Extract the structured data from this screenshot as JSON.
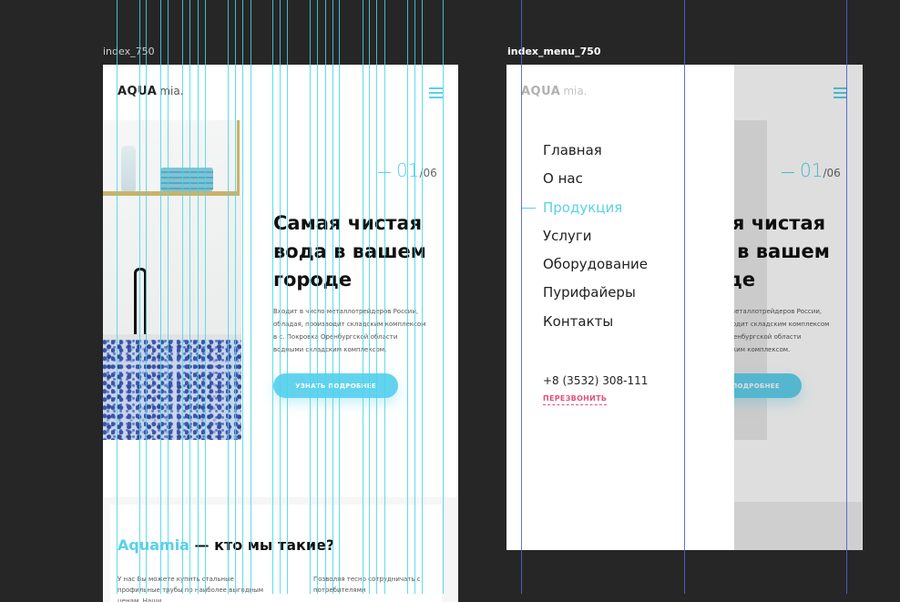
{
  "artboards": {
    "left_label": "index_750",
    "right_label": "index_menu_750"
  },
  "logo": {
    "brand": "AQUA",
    "suffix": "mia."
  },
  "hero": {
    "slide_current": "01",
    "slide_total": "/06",
    "title_line1": "Самая чистая",
    "title_line2": "вода в вашем",
    "title_line3": "городе",
    "desc_line1": "Входит в число металлотрейдеров России,",
    "desc_line2": "обладая, производит складским комплексом",
    "desc_line3": "в с. Покровка Оренбургской области",
    "desc_line4": "водными складским комплексом.",
    "cta_label": "УЗНАТЬ ПОДРОБНЕЕ"
  },
  "about": {
    "title_accent": "Aquamia",
    "title_rest": " — кто мы такие?",
    "col1": "У нас Вы можете купить стальные профильные трубы по наиболее выгодным ценам. Наши",
    "col2": "Позволяя тесно сотрудничать с потребителями"
  },
  "menu": {
    "items": [
      {
        "label": "Главная"
      },
      {
        "label": "О нас"
      },
      {
        "label": "Продукция"
      },
      {
        "label": "Услуги"
      },
      {
        "label": "Оборудование"
      },
      {
        "label": "Пурифайеры"
      },
      {
        "label": "Контакты"
      }
    ],
    "active_index": 2,
    "phone": "+8 (3532) 308-111",
    "callback_label": "ПЕРЕЗВОНИТЬ"
  },
  "colors": {
    "accent": "#5ad0ea",
    "button": "#62d3ee",
    "callback": "#e2507a",
    "canvas": "#262626",
    "guide_cyan": "#46d6e6",
    "guide_blue": "#4a63d6"
  },
  "icons": {
    "menu": "hamburger-icon"
  }
}
